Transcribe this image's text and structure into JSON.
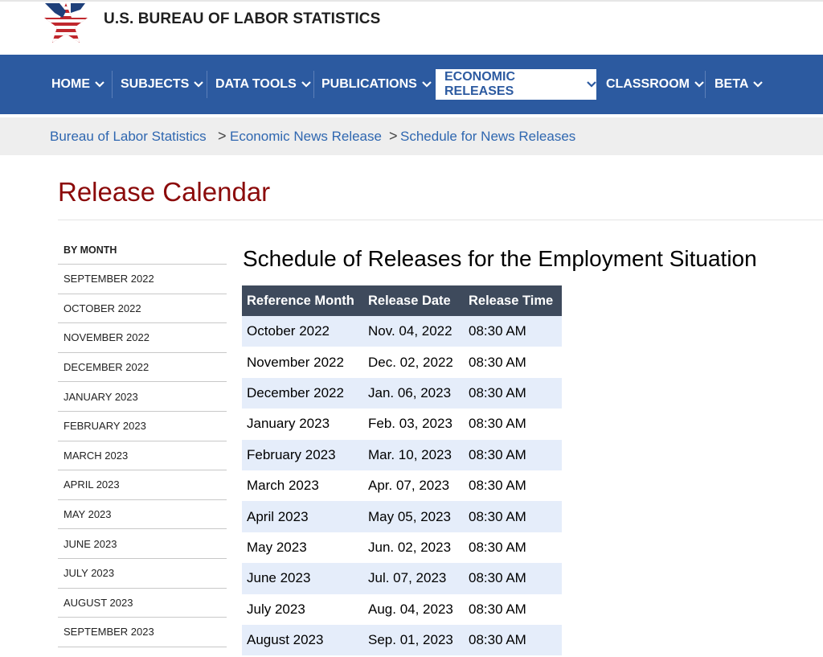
{
  "header": {
    "agency_name": "U.S. BUREAU OF LABOR STATISTICS"
  },
  "nav": {
    "items": [
      {
        "label": "HOME"
      },
      {
        "label": "SUBJECTS"
      },
      {
        "label": "DATA TOOLS"
      },
      {
        "label": "PUBLICATIONS"
      },
      {
        "label": "ECONOMIC RELEASES",
        "active": true
      },
      {
        "label": "CLASSROOM"
      },
      {
        "label": "BETA"
      }
    ]
  },
  "breadcrumb": {
    "items": [
      "Bureau of Labor Statistics",
      "Economic News Release",
      "Schedule for News Releases"
    ],
    "separator": ">"
  },
  "page": {
    "title": "Release Calendar",
    "section_title": "Schedule of Releases for the Employment Situation"
  },
  "sidebar": {
    "heading": "BY MONTH",
    "items": [
      "SEPTEMBER 2022",
      "OCTOBER 2022",
      "NOVEMBER 2022",
      "DECEMBER 2022",
      "JANUARY 2023",
      "FEBRUARY 2023",
      "MARCH 2023",
      "APRIL 2023",
      "MAY 2023",
      "JUNE 2023",
      "JULY 2023",
      "AUGUST 2023",
      "SEPTEMBER 2023"
    ]
  },
  "schedule": {
    "columns": [
      "Reference Month",
      "Release Date",
      "Release Time"
    ],
    "rows": [
      [
        "October 2022",
        "Nov. 04, 2022",
        "08:30 AM"
      ],
      [
        "November 2022",
        "Dec. 02, 2022",
        "08:30 AM"
      ],
      [
        "December 2022",
        "Jan. 06, 2023",
        "08:30 AM"
      ],
      [
        "January 2023",
        "Feb. 03, 2023",
        "08:30 AM"
      ],
      [
        "February 2023",
        "Mar. 10, 2023",
        "08:30 AM"
      ],
      [
        "March 2023",
        "Apr. 07, 2023",
        "08:30 AM"
      ],
      [
        "April 2023",
        "May 05, 2023",
        "08:30 AM"
      ],
      [
        "May 2023",
        "Jun. 02, 2023",
        "08:30 AM"
      ],
      [
        "June 2023",
        "Jul. 07, 2023",
        "08:30 AM"
      ],
      [
        "July 2023",
        "Aug. 04, 2023",
        "08:30 AM"
      ],
      [
        "August 2023",
        "Sep. 01, 2023",
        "08:30 AM"
      ]
    ]
  },
  "colors": {
    "nav_bg": "#2c5aa0",
    "title_red": "#8b0a0a",
    "link_blue": "#2f67b0",
    "table_header": "#3e4a5c",
    "row_stripe": "#e5edfa"
  },
  "icons": {
    "logo": "bls-star-logo-icon",
    "nav_dropdown": "chevron-down-icon"
  }
}
